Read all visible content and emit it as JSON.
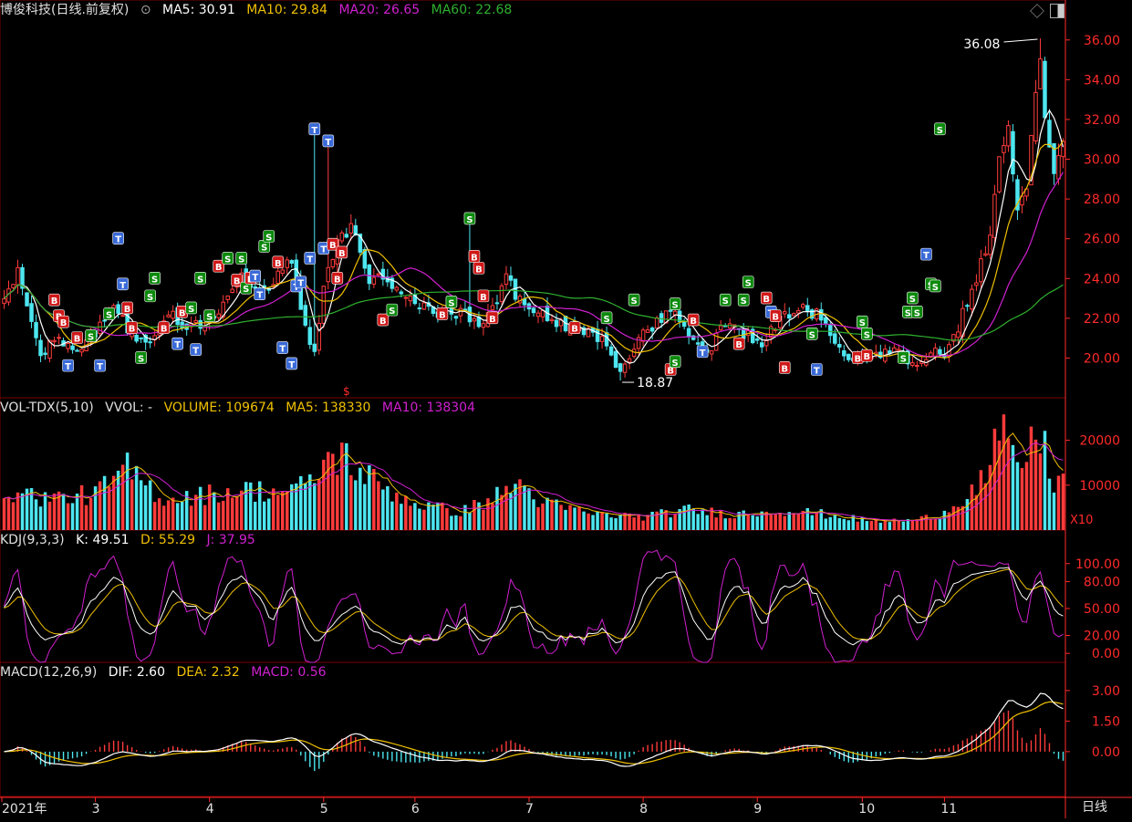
{
  "colors": {
    "up": "#ff3b3b",
    "down": "#4de6f0",
    "ma5": "#ffffff",
    "ma10": "#f0c000",
    "ma20": "#d020d0",
    "ma60": "#2fb02f",
    "grid": "#7a0000",
    "axis": "#ff2a2a",
    "text": "#e0e0e0"
  },
  "main_header": {
    "name": "博俊科技(日线.前复权)",
    "ma5": "MA5: 30.91",
    "ma10": "MA10: 29.84",
    "ma20": "MA20: 26.65",
    "ma60": "MA60: 22.68"
  },
  "vol_header": {
    "name": "VOL-TDX(5,10)",
    "vvol": "VVOL: -",
    "volume": "VOLUME: 109674",
    "ma5": "MA5: 138330",
    "ma10": "MA10: 138304"
  },
  "kdj_header": {
    "name": "KDJ(9,3,3)",
    "k": "K: 49.51",
    "d": "D: 55.29",
    "j": "J: 37.95"
  },
  "macd_header": {
    "name": "MACD(12,26,9)",
    "dif": "DIF: 2.60",
    "dea": "DEA: 2.32",
    "macd": "MACD: 0.56"
  },
  "footer": {
    "period": "日线"
  },
  "annotations": {
    "high": "36.08",
    "low": "18.87",
    "marker": "$"
  },
  "chart_data": [
    {
      "type": "candlestick",
      "panel": "price",
      "yticks": [
        "36.00",
        "34.00",
        "32.00",
        "30.00",
        "28.00",
        "26.00",
        "24.00",
        "22.00",
        "20.00"
      ],
      "ylim": [
        18.0,
        37.0
      ],
      "xticks": [
        {
          "label": "2021年",
          "day": 0
        },
        {
          "label": "3",
          "day": 20
        },
        {
          "label": "4",
          "day": 45
        },
        {
          "label": "5",
          "day": 70
        },
        {
          "label": "6",
          "day": 90
        },
        {
          "label": "7",
          "day": 115
        },
        {
          "label": "8",
          "day": 140
        },
        {
          "label": "9",
          "day": 165
        },
        {
          "label": "10",
          "day": 188
        },
        {
          "label": "11",
          "day": 206
        }
      ],
      "anchors": [
        [
          0,
          22.8
        ],
        [
          3,
          24.2
        ],
        [
          6,
          22.0
        ],
        [
          8,
          20.2
        ],
        [
          12,
          21.0
        ],
        [
          16,
          20.5
        ],
        [
          20,
          21.2
        ],
        [
          24,
          22.5
        ],
        [
          28,
          21.2
        ],
        [
          32,
          21.0
        ],
        [
          36,
          22.4
        ],
        [
          40,
          21.5
        ],
        [
          44,
          21.8
        ],
        [
          48,
          22.8
        ],
        [
          52,
          24.0
        ],
        [
          56,
          23.2
        ],
        [
          60,
          24.2
        ],
        [
          63,
          24.8
        ],
        [
          66,
          21.5
        ],
        [
          68,
          20.2
        ],
        [
          70,
          23.5
        ],
        [
          73,
          25.8
        ],
        [
          76,
          26.5
        ],
        [
          78,
          25.5
        ],
        [
          80,
          24.0
        ],
        [
          84,
          23.8
        ],
        [
          88,
          23.2
        ],
        [
          92,
          22.5
        ],
        [
          96,
          22.3
        ],
        [
          100,
          22.2
        ],
        [
          104,
          21.8
        ],
        [
          108,
          22.5
        ],
        [
          110,
          24.5
        ],
        [
          112,
          23.2
        ],
        [
          116,
          22.6
        ],
        [
          120,
          22.0
        ],
        [
          124,
          21.5
        ],
        [
          128,
          21.2
        ],
        [
          132,
          20.8
        ],
        [
          135,
          19.3
        ],
        [
          138,
          20.6
        ],
        [
          142,
          21.6
        ],
        [
          146,
          22.5
        ],
        [
          150,
          21.0
        ],
        [
          154,
          20.2
        ],
        [
          158,
          21.8
        ],
        [
          162,
          21.2
        ],
        [
          166,
          20.8
        ],
        [
          170,
          22.0
        ],
        [
          174,
          22.6
        ],
        [
          178,
          22.2
        ],
        [
          181,
          21.2
        ],
        [
          184,
          20.0
        ],
        [
          188,
          20.1
        ],
        [
          192,
          20.3
        ],
        [
          196,
          20.2
        ],
        [
          200,
          19.6
        ],
        [
          203,
          20.4
        ],
        [
          206,
          20.3
        ],
        [
          208,
          21.0
        ],
        [
          211,
          22.8
        ],
        [
          214,
          24.8
        ],
        [
          216,
          25.8
        ],
        [
          218,
          30.0
        ],
        [
          220,
          31.5
        ],
        [
          222,
          27.2
        ],
        [
          224,
          28.6
        ],
        [
          226,
          33.2
        ],
        [
          227,
          35.0
        ],
        [
          228,
          32.0
        ],
        [
          230,
          29.2
        ],
        [
          232,
          30.9
        ]
      ],
      "volume_anchors": [
        [
          0,
          9000
        ],
        [
          10,
          7000
        ],
        [
          20,
          8000
        ],
        [
          27,
          13500
        ],
        [
          35,
          7000
        ],
        [
          45,
          8000
        ],
        [
          52,
          9000
        ],
        [
          60,
          8500
        ],
        [
          67,
          10000
        ],
        [
          70,
          15000
        ],
        [
          74,
          17000
        ],
        [
          78,
          13000
        ],
        [
          84,
          9000
        ],
        [
          90,
          6000
        ],
        [
          100,
          4000
        ],
        [
          110,
          8500
        ],
        [
          112,
          11000
        ],
        [
          118,
          6000
        ],
        [
          130,
          3500
        ],
        [
          140,
          3000
        ],
        [
          150,
          4500
        ],
        [
          160,
          3500
        ],
        [
          170,
          4500
        ],
        [
          180,
          3500
        ],
        [
          190,
          2000
        ],
        [
          200,
          2200
        ],
        [
          206,
          4000
        ],
        [
          212,
          9000
        ],
        [
          216,
          13000
        ],
        [
          218,
          22000
        ],
        [
          221,
          15500
        ],
        [
          224,
          16000
        ],
        [
          227,
          22000
        ],
        [
          230,
          10500
        ],
        [
          232,
          11000
        ]
      ],
      "high_label": "36.08",
      "low_label": "18.87",
      "signals": [
        {
          "t": "B",
          "day": 11,
          "v": 22.9
        },
        {
          "t": "B",
          "day": 12,
          "v": 22.1
        },
        {
          "t": "B",
          "day": 13,
          "v": 21.8
        },
        {
          "t": "T",
          "day": 14,
          "v": 19.6
        },
        {
          "t": "S",
          "day": 19,
          "v": 21.1
        },
        {
          "t": "T",
          "day": 21,
          "v": 19.6
        },
        {
          "t": "B",
          "day": 16,
          "v": 21.0
        },
        {
          "t": "S",
          "day": 23,
          "v": 22.2
        },
        {
          "t": "T",
          "day": 25,
          "v": 26.0
        },
        {
          "t": "T",
          "day": 26,
          "v": 23.7
        },
        {
          "t": "B",
          "day": 27,
          "v": 22.5
        },
        {
          "t": "B",
          "day": 28,
          "v": 21.5
        },
        {
          "t": "S",
          "day": 30,
          "v": 20.0
        },
        {
          "t": "S",
          "day": 32,
          "v": 23.1
        },
        {
          "t": "S",
          "day": 33,
          "v": 24.0
        },
        {
          "t": "B",
          "day": 35,
          "v": 21.5
        },
        {
          "t": "T",
          "day": 38,
          "v": 20.7
        },
        {
          "t": "B",
          "day": 39,
          "v": 22.3
        },
        {
          "t": "S",
          "day": 41,
          "v": 22.5
        },
        {
          "t": "T",
          "day": 42,
          "v": 20.4
        },
        {
          "t": "S",
          "day": 43,
          "v": 24.0
        },
        {
          "t": "S",
          "day": 45,
          "v": 22.1
        },
        {
          "t": "B",
          "day": 47,
          "v": 24.6
        },
        {
          "t": "S",
          "day": 49,
          "v": 25.0
        },
        {
          "t": "B",
          "day": 51,
          "v": 23.9
        },
        {
          "t": "S",
          "day": 52,
          "v": 25.0
        },
        {
          "t": "S",
          "day": 53,
          "v": 23.5
        },
        {
          "t": "B",
          "day": 54,
          "v": 24.0
        },
        {
          "t": "T",
          "day": 55,
          "v": 24.1
        },
        {
          "t": "T",
          "day": 56,
          "v": 23.2
        },
        {
          "t": "S",
          "day": 57,
          "v": 25.6
        },
        {
          "t": "S",
          "day": 58,
          "v": 26.1
        },
        {
          "t": "B",
          "day": 60,
          "v": 24.8
        },
        {
          "t": "T",
          "day": 61,
          "v": 20.5
        },
        {
          "t": "T",
          "day": 63,
          "v": 19.7
        },
        {
          "t": "T",
          "day": 64,
          "v": 23.6
        },
        {
          "t": "T",
          "day": 65,
          "v": 23.8
        },
        {
          "t": "T",
          "day": 67,
          "v": 25.0
        },
        {
          "t": "T",
          "day": 68,
          "v": 31.5
        },
        {
          "t": "T",
          "day": 70,
          "v": 25.5
        },
        {
          "t": "T",
          "day": 71,
          "v": 30.9
        },
        {
          "t": "B",
          "day": 72,
          "v": 25.7
        },
        {
          "t": "B",
          "day": 74,
          "v": 25.3
        },
        {
          "t": "B",
          "day": 73,
          "v": 24.0
        },
        {
          "t": "B",
          "day": 83,
          "v": 21.9
        },
        {
          "t": "S",
          "day": 85,
          "v": 22.4
        },
        {
          "t": "S",
          "day": 98,
          "v": 22.8
        },
        {
          "t": "B",
          "day": 96,
          "v": 22.2
        },
        {
          "t": "S",
          "day": 102,
          "v": 27.0
        },
        {
          "t": "B",
          "day": 103,
          "v": 25.1
        },
        {
          "t": "B",
          "day": 104,
          "v": 24.5
        },
        {
          "t": "B",
          "day": 105,
          "v": 23.1
        },
        {
          "t": "B",
          "day": 107,
          "v": 22.0
        },
        {
          "t": "B",
          "day": 125,
          "v": 21.5
        },
        {
          "t": "S",
          "day": 132,
          "v": 22.0
        },
        {
          "t": "S",
          "day": 138,
          "v": 22.9
        },
        {
          "t": "S",
          "day": 147,
          "v": 22.7
        },
        {
          "t": "B",
          "day": 146,
          "v": 19.4
        },
        {
          "t": "S",
          "day": 147,
          "v": 19.8
        },
        {
          "t": "B",
          "day": 151,
          "v": 21.9
        },
        {
          "t": "T",
          "day": 153,
          "v": 20.3
        },
        {
          "t": "S",
          "day": 158,
          "v": 22.9
        },
        {
          "t": "S",
          "day": 162,
          "v": 22.9
        },
        {
          "t": "B",
          "day": 161,
          "v": 20.7
        },
        {
          "t": "S",
          "day": 163,
          "v": 23.8
        },
        {
          "t": "B",
          "day": 167,
          "v": 23.0
        },
        {
          "t": "T",
          "day": 168,
          "v": 22.3
        },
        {
          "t": "B",
          "day": 169,
          "v": 22.1
        },
        {
          "t": "B",
          "day": 171,
          "v": 19.5
        },
        {
          "t": "S",
          "day": 177,
          "v": 21.2
        },
        {
          "t": "T",
          "day": 178,
          "v": 19.4
        },
        {
          "t": "B",
          "day": 187,
          "v": 20.0
        },
        {
          "t": "S",
          "day": 188,
          "v": 21.8
        },
        {
          "t": "S",
          "day": 189,
          "v": 21.2
        },
        {
          "t": "B",
          "day": 189,
          "v": 20.1
        },
        {
          "t": "S",
          "day": 197,
          "v": 20.0
        },
        {
          "t": "S",
          "day": 198,
          "v": 22.3
        },
        {
          "t": "S",
          "day": 199,
          "v": 23.0
        },
        {
          "t": "S",
          "day": 200,
          "v": 22.3
        },
        {
          "t": "T",
          "day": 202,
          "v": 25.2
        },
        {
          "t": "S",
          "day": 203,
          "v": 23.7
        },
        {
          "t": "S",
          "day": 204,
          "v": 23.6
        },
        {
          "t": "S",
          "day": 205,
          "v": 31.5
        }
      ]
    },
    {
      "type": "bar",
      "panel": "volume",
      "yticks": [
        "20000",
        "10000"
      ],
      "unit": "X10",
      "ylim": [
        0,
        25000
      ]
    },
    {
      "type": "line",
      "panel": "kdj",
      "yticks": [
        "100.00",
        "80.00",
        "50.00",
        "20.00",
        "0.00"
      ],
      "ylim": [
        -10,
        115
      ],
      "series": [
        {
          "name": "K",
          "last": 49.51
        },
        {
          "name": "D",
          "last": 55.29
        },
        {
          "name": "J",
          "last": 37.95
        }
      ]
    },
    {
      "type": "bar",
      "panel": "macd",
      "yticks": [
        "3.00",
        "1.50",
        "0.00"
      ],
      "ylim": [
        -2.2,
        3.4
      ],
      "series": [
        {
          "name": "DIF",
          "last": 2.6
        },
        {
          "name": "DEA",
          "last": 2.32
        },
        {
          "name": "MACD",
          "last": 0.56
        }
      ]
    }
  ]
}
